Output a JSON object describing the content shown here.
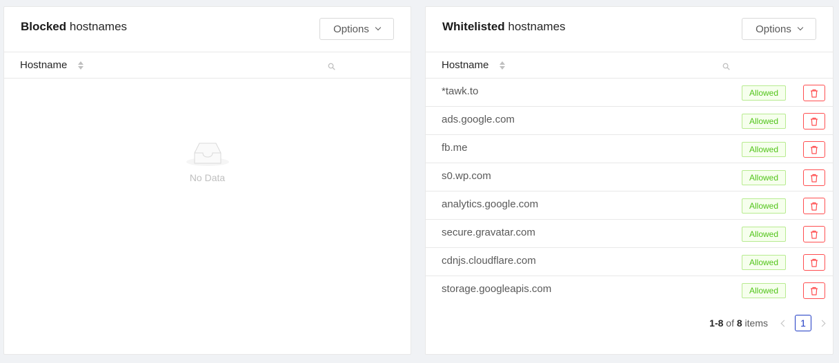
{
  "blocked": {
    "title_bold": "Blocked",
    "title_rest": " hostnames",
    "options_label": "Options",
    "column_header": "Hostname",
    "empty_text": "No Data"
  },
  "whitelisted": {
    "title_bold": "Whitelisted",
    "title_rest": " hostnames",
    "options_label": "Options",
    "column_header": "Hostname",
    "rows": [
      {
        "host": "*tawk.to",
        "status": "Allowed"
      },
      {
        "host": "ads.google.com",
        "status": "Allowed"
      },
      {
        "host": "fb.me",
        "status": "Allowed"
      },
      {
        "host": "s0.wp.com",
        "status": "Allowed"
      },
      {
        "host": "analytics.google.com",
        "status": "Allowed"
      },
      {
        "host": "secure.gravatar.com",
        "status": "Allowed"
      },
      {
        "host": "cdnjs.cloudflare.com",
        "status": "Allowed"
      },
      {
        "host": "storage.googleapis.com",
        "status": "Allowed"
      }
    ],
    "pagination": {
      "range": "1-8",
      "of": " of ",
      "total": "8",
      "items_label": " items",
      "current_page": "1"
    }
  },
  "colors": {
    "allowed_tag": "#52c41a",
    "delete": "#ff4d4f",
    "active_page": "#1d39c4"
  }
}
